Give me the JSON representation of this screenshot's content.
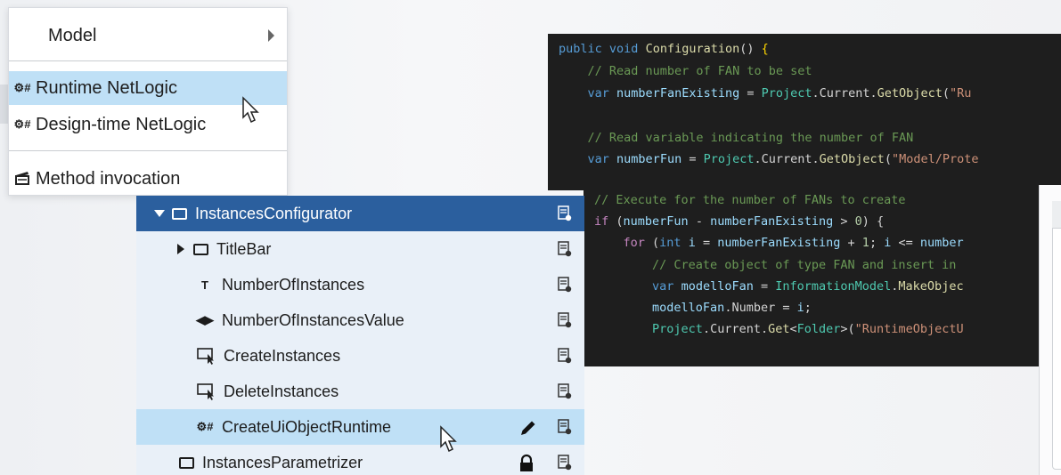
{
  "menu": {
    "items": [
      {
        "label": "Model",
        "icon": "",
        "submenu": true,
        "selected": false
      },
      {
        "label": "Runtime NetLogic",
        "icon": "⚙#",
        "submenu": false,
        "selected": true
      },
      {
        "label": "Design-time NetLogic",
        "icon": "⚙#",
        "submenu": false,
        "selected": false
      },
      {
        "label": "Method invocation",
        "icon": "clapper-icon",
        "submenu": false,
        "selected": false
      }
    ]
  },
  "code_top": [
    "public void Configuration() {",
    "    // Read number of FAN to be set",
    "    var numberFanExisting = Project.Current.GetObject(\"Ru",
    "",
    "    // Read variable indicating the number of FAN",
    "    var numberFun = Project.Current.GetObject(\"Model/Prote"
  ],
  "code_bottom": [
    "// Execute for the number of FANs to create",
    "if (numberFun - numberFanExisting > 0) {",
    "    for (int i = numberFanExisting + 1; i <= number",
    "        // Create object of type FAN and insert in",
    "        var modelloFan = InformationModel.MakeObjec",
    "        modelloFan.Number = i;",
    "        Project.Current.Get<Folder>(\"RuntimeObjectU"
  ],
  "tree": {
    "rows": [
      {
        "label": "InstancesConfigurator",
        "type": "panel",
        "expanded": true
      },
      {
        "label": "TitleBar",
        "type": "panel",
        "expanded": false
      },
      {
        "label": "NumberOfInstances",
        "type": "label"
      },
      {
        "label": "NumberOfInstancesValue",
        "type": "spinbox"
      },
      {
        "label": "CreateInstances",
        "type": "button"
      },
      {
        "label": "DeleteInstances",
        "type": "button"
      },
      {
        "label": "CreateUiObjectRuntime",
        "type": "netlogic",
        "selected": true
      },
      {
        "label": "InstancesParametrizer",
        "type": "panel",
        "locked": true
      }
    ]
  },
  "colors": {
    "tree_header": "#2b5f9e",
    "selection": "#bfe0f6",
    "code_bg": "#1e1e1e"
  }
}
